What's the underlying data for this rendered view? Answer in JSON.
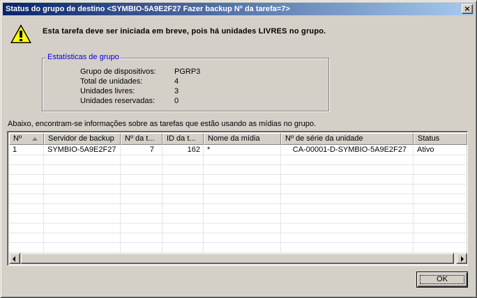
{
  "window": {
    "title": "Status do grupo de destino <SYMBIO-5A9E2F27 Fazer backup Nº da tarefa=7>",
    "close_label": "×"
  },
  "message": "Esta tarefa deve ser iniciada em breve, pois há unidades LIVRES no grupo.",
  "stats": {
    "legend": "Estatísticas de grupo",
    "rows": [
      {
        "label": "Grupo de dispositivos:",
        "value": "PGRP3"
      },
      {
        "label": "Total de unidades:",
        "value": "4"
      },
      {
        "label": "Unidades livres:",
        "value": "3"
      },
      {
        "label": "Unidades reservadas:",
        "value": "0"
      }
    ]
  },
  "info_text": "Abaixo, encontram-se informações sobre as tarefas que estão usando as mídias no grupo.",
  "table": {
    "columns": [
      "Nº",
      "Servidor de backup",
      "Nº da t...",
      "ID da t...",
      "Nome da mídia",
      "Nº de série da unidade",
      "Status"
    ],
    "rows": [
      [
        "1",
        "SYMBIO-5A9E2F27",
        "7",
        "162",
        "*",
        "CA-00001-D-SYMBIO-5A9E2F27",
        "Ativo"
      ]
    ]
  },
  "ok_label": "OK",
  "icons": {
    "warning": "warning-icon",
    "scroll_left": "scroll-left-arrow-icon",
    "scroll_right": "scroll-right-arrow-icon"
  }
}
